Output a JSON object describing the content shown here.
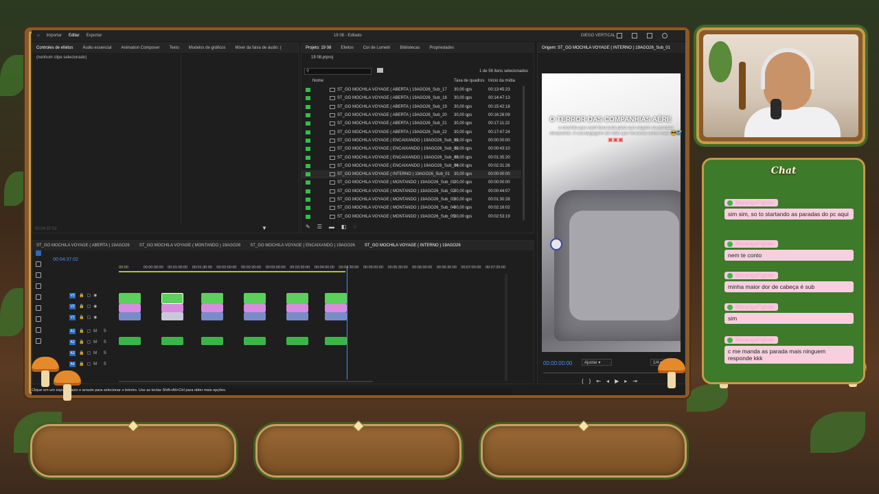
{
  "app": {
    "workspaces": [
      "Importar",
      "Editar",
      "Exportar"
    ],
    "active_workspace": "Editar",
    "window_title": "19 08 - Editado",
    "user": "DIEGO VERTICAL"
  },
  "effects_panel": {
    "tabs": [
      "Controles de efeitos",
      "Áudio essencial",
      "Animation Composer",
      "Texto",
      "Modelos de gráficos",
      "Mixer da faixa de áudio: ("
    ],
    "empty_text": "(nenhum clipe selecionado)",
    "footer_tc": "00:04:37:02"
  },
  "project_panel": {
    "tabs": [
      "Projeto: 19 08",
      "Efeitos",
      "Cor de Lumetri",
      "Bibliotecas",
      "Propriedades"
    ],
    "file": "19 08.prproj",
    "count": "1 de 56 itens selecionados",
    "columns": {
      "name": "Nome",
      "fps": "Taxa de quadros",
      "start": "Início da mídia"
    },
    "rows": [
      {
        "name": "ST_GO MOCHILA VOYAGE ( ABERTA ) 19AGO26_Sub_17",
        "fps": "30,00 qps",
        "tc": "00:13:45:23"
      },
      {
        "name": "ST_GO MOCHILA VOYAGE ( ABERTA ) 19AGO26_Sub_18",
        "fps": "30,00 qps",
        "tc": "00:14:47:13"
      },
      {
        "name": "ST_GO MOCHILA VOYAGE ( ABERTA ) 19AGO26_Sub_19",
        "fps": "30,00 qps",
        "tc": "00:15:42:18"
      },
      {
        "name": "ST_GO MOCHILA VOYAGE ( ABERTA ) 19AGO26_Sub_20",
        "fps": "30,00 qps",
        "tc": "00:16:26:09"
      },
      {
        "name": "ST_GO MOCHILA VOYAGE ( ABERTA ) 19AGO26_Sub_21",
        "fps": "30,00 qps",
        "tc": "00:17:11:22"
      },
      {
        "name": "ST_GO MOCHILA VOYAGE ( ABERTA ) 19AGO26_Sub_22",
        "fps": "30,00 qps",
        "tc": "00:17:47:24"
      },
      {
        "name": "ST_GO MOCHILA VOYAGE ( ENCAIXANDO ) 19AGO26_Sub_01",
        "fps": "30,00 qps",
        "tc": "00:00:00:00"
      },
      {
        "name": "ST_GO MOCHILA VOYAGE ( ENCAIXANDO ) 19AGO26_Sub_02",
        "fps": "30,00 qps",
        "tc": "00:00:43:10"
      },
      {
        "name": "ST_GO MOCHILA VOYAGE ( ENCAIXANDO ) 19AGO26_Sub_03",
        "fps": "30,00 qps",
        "tc": "00:01:35:20"
      },
      {
        "name": "ST_GO MOCHILA VOYAGE ( ENCAIXANDO ) 19AGO26_Sub_04",
        "fps": "30,00 qps",
        "tc": "00:02:31:26"
      },
      {
        "name": "ST_GO MOCHILA VOYAGE ( INTERNO ) 19AGO26_Sub_01",
        "fps": "30,00 qps",
        "tc": "00:00:00:00"
      },
      {
        "name": "ST_GO MOCHILA VOYAGE ( MONTANDO ) 19AGO26_Sub_01",
        "fps": "30,00 qps",
        "tc": "00:00:00:00"
      },
      {
        "name": "ST_GO MOCHILA VOYAGE ( MONTANDO ) 19AGO26_Sub_02",
        "fps": "30,00 qps",
        "tc": "00:00:44:07"
      },
      {
        "name": "ST_GO MOCHILA VOYAGE ( MONTANDO ) 19AGO26_Sub_03",
        "fps": "30,00 qps",
        "tc": "00:01:30:28"
      },
      {
        "name": "ST_GO MOCHILA VOYAGE ( MONTANDO ) 19AGO26_Sub_04",
        "fps": "30,00 qps",
        "tc": "00:02:16:02"
      },
      {
        "name": "ST_GO MOCHILA VOYAGE ( MONTANDO ) 19AGO26_Sub_05",
        "fps": "30,00 qps",
        "tc": "00:02:53:19"
      }
    ]
  },
  "program_monitor": {
    "title": "Origem: ST_GO MOCHILA VOYAGE ( INTERNO ) 19AGO26_Sub_01",
    "overlay_title": "O TERROR DAS COMPANHIAS AÉRE",
    "overlay_sub": "a mochila que você leva tudo para sua viagem se precisar despachar. A sua bagagem de mão que funciona como mala 😎✈️",
    "timecode": "00:00:00:00",
    "fit": "Ajustar",
    "resolution": "1/4"
  },
  "timeline": {
    "tabs": [
      "ST_GO MOCHILA VOYAGE ( ABERTA ) 19AGO26",
      "ST_GO MOCHILA VOYAGE ( MONTANDO ) 19AGO26",
      "ST_GO MOCHILA VOYAGE ( ENCAIXANDO ) 19AGO26",
      "ST_GO MOCHILA VOYAGE ( INTERNO ) 19AGO26"
    ],
    "timecode": "00:04:37:02",
    "ruler": [
      "00:00",
      "00:00:30:00",
      "00:01:00:00",
      "00:01:30:00",
      "00:02:00:00",
      "00:02:30:00",
      "00:03:00:00",
      "00:03:30:00",
      "00:04:00:00",
      "00:04:30:00",
      "00:05:00:00",
      "00:05:30:00",
      "00:06:00:00",
      "00:06:30:00",
      "00:07:00:00",
      "00:07:30:00"
    ],
    "video_tracks": [
      "V3",
      "V2",
      "V1"
    ],
    "audio_tracks": [
      "A1",
      "A2",
      "A3",
      "A4"
    ],
    "status": "Clique em um espaço vazio e arraste para selecionar o letreiro. Use as teclas Shift+Alt+Ctrl para obter mais opções."
  },
  "chat": {
    "title": "Chat",
    "messages": [
      {
        "user": "MorangoFighter",
        "text": "sim sim, so to startando as paradas do pc aqui"
      },
      {
        "user": "MorangoFighter",
        "text": "nem te conto"
      },
      {
        "user": "MorangoFighter",
        "text": "minha maior dor de cabeça é sub"
      },
      {
        "user": "MorangoFighter",
        "text": "sim"
      },
      {
        "user": "MorangoFighter",
        "text": "c me manda as parada mais ninguem responde kkk"
      }
    ]
  },
  "colors": {
    "label_green": "#2fbf4a",
    "clip_pink": "#d98be0",
    "timecode_blue": "#4d8cff",
    "chat_bubble": "#f9cfe0"
  }
}
